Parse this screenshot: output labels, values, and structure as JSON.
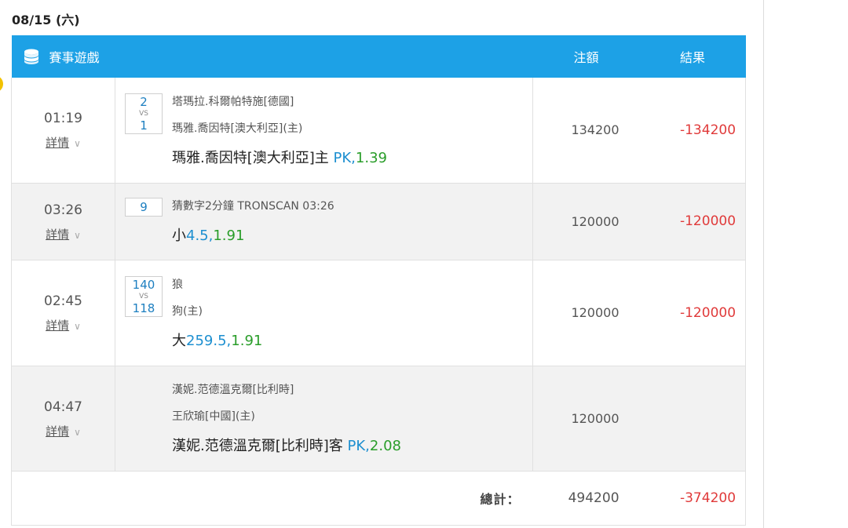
{
  "date": "08/15 (六)",
  "header": {
    "game": "賽事遊戲",
    "amount": "注額",
    "result": "結果"
  },
  "detail_label": "詳情",
  "rows": [
    {
      "time": "01:19",
      "score1": "2",
      "vs": "VS",
      "score2": "1",
      "team1": "塔瑪拉.科爾帕特施[德國]",
      "team2": "瑪雅.喬因特[澳大利亞](主)",
      "pick_text": "瑪雅.喬因特[澳大利亞]主 ",
      "pick_line": "PK,",
      "pick_odds": "1.39",
      "amount": "134200",
      "result": "-134200"
    },
    {
      "time": "03:26",
      "score1": "9",
      "team1": "猜數字2分鐘 TRONSCAN 03:26",
      "pick_text": "小",
      "pick_line": "4.5,",
      "pick_odds": "1.91",
      "amount": "120000",
      "result": "-120000"
    },
    {
      "time": "02:45",
      "score1": "140",
      "vs": "VS",
      "score2": "118",
      "team1": "狼",
      "team2": "狗(主)",
      "pick_text": "大",
      "pick_line": "259.5,",
      "pick_odds": "1.91",
      "amount": "120000",
      "result": "-120000"
    },
    {
      "time": "04:47",
      "team1": "漢妮.范德溫克爾[比利時]",
      "team2": "王欣瑜[中國](主)",
      "pick_text": "漢妮.范德溫克爾[比利時]客 ",
      "pick_line": "PK,",
      "pick_odds": "2.08",
      "amount": "120000",
      "result": ""
    }
  ],
  "total": {
    "label": "總計：",
    "amount": "494200",
    "result": "-374200"
  },
  "colors": {
    "header_bg": "#1da1e6",
    "negative": "#e03a3a",
    "line_blue": "#1d8fd0",
    "odds_green": "#2a9d2a"
  },
  "icons": {
    "header": "database-icon",
    "detail": "chevron-down-icon"
  }
}
